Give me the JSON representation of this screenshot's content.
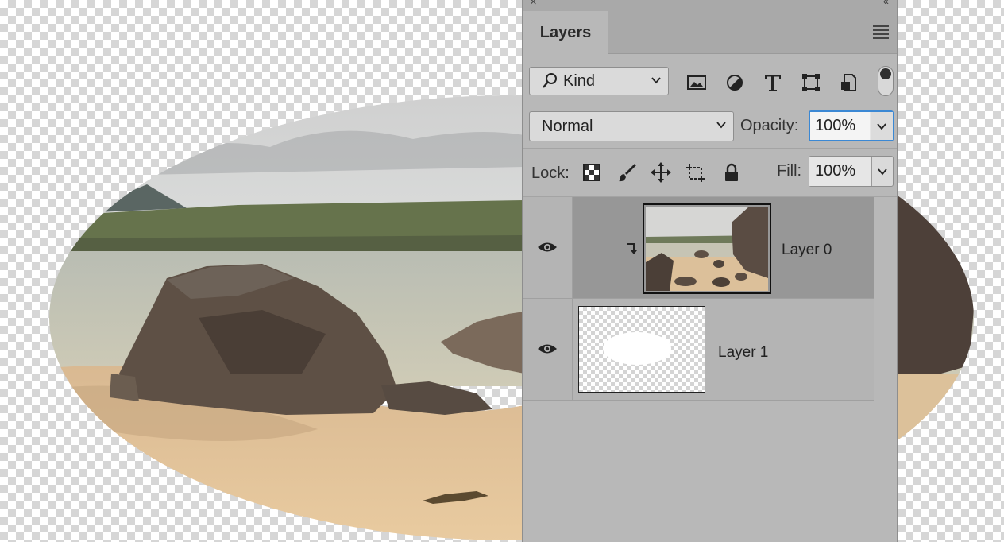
{
  "panel": {
    "tab_label": "Layers",
    "filter": {
      "kind_label": "Kind",
      "icons": [
        "pixel-filter-icon",
        "adjustment-filter-icon",
        "type-filter-icon",
        "shape-filter-icon",
        "smart-object-filter-icon"
      ]
    },
    "blend_mode": "Normal",
    "opacity_label": "Opacity:",
    "opacity_value": "100%",
    "lock_label": "Lock:",
    "lock_icons": [
      "lock-transparent-pixels-icon",
      "lock-image-pixels-icon",
      "lock-position-icon",
      "lock-artboard-icon",
      "lock-all-icon"
    ],
    "fill_label": "Fill:",
    "fill_value": "100%",
    "layers": [
      {
        "name": "Layer 0",
        "visible": true,
        "selected": true,
        "clipped": true,
        "thumbnail": "beach-photo"
      },
      {
        "name": "Layer 1",
        "visible": true,
        "selected": false,
        "clipped": false,
        "thumbnail": "white-oval-on-transparency"
      }
    ]
  },
  "colors": {
    "panel_bg": "#b8b8b8",
    "selected_layer": "#979797",
    "focus_accent": "#3b88d4"
  }
}
